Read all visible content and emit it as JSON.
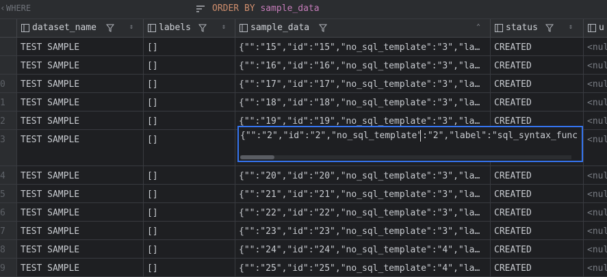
{
  "filter": {
    "where_label": "WHERE",
    "order_keyword": "ORDER BY",
    "order_field": "sample_data"
  },
  "columns": [
    {
      "name": "dataset_name",
      "has_filter": true,
      "has_sort": true
    },
    {
      "name": "labels",
      "has_filter": true,
      "has_sort": true
    },
    {
      "name": "sample_data",
      "has_filter": true,
      "has_sort": true
    },
    {
      "name": "status",
      "has_filter": true,
      "has_sort": true
    },
    {
      "name": "u",
      "has_filter": false,
      "has_sort": false
    }
  ],
  "rows": [
    {
      "num": "",
      "dataset_name": "TEST SAMPLE",
      "labels": "[]",
      "sample_data": "{\"\":\"15\",\"id\":\"15\",\"no_sql_template\":\"3\",\"la…",
      "status": "CREATED",
      "u": "<nul"
    },
    {
      "num": "",
      "dataset_name": "TEST SAMPLE",
      "labels": "[]",
      "sample_data": "{\"\":\"16\",\"id\":\"16\",\"no_sql_template\":\"3\",\"la…",
      "status": "CREATED",
      "u": "<nul"
    },
    {
      "num": "0",
      "dataset_name": "TEST SAMPLE",
      "labels": "[]",
      "sample_data": "{\"\":\"17\",\"id\":\"17\",\"no_sql_template\":\"3\",\"la…",
      "status": "CREATED",
      "u": "<nul"
    },
    {
      "num": "1",
      "dataset_name": "TEST SAMPLE",
      "labels": "[]",
      "sample_data": "{\"\":\"18\",\"id\":\"18\",\"no_sql_template\":\"3\",\"la…",
      "status": "CREATED",
      "u": "<nul"
    },
    {
      "num": "2",
      "dataset_name": "TEST SAMPLE",
      "labels": "[]",
      "sample_data": "{\"\":\"19\",\"id\":\"19\",\"no_sql_template\":\"3\",\"la…",
      "status": "CREATED",
      "u": "<nul"
    },
    {
      "num": "3",
      "dataset_name": "TEST SAMPLE",
      "labels": "[]",
      "sample_data": "",
      "status": "",
      "u": "<nul",
      "editing": true
    },
    {
      "num": "4",
      "dataset_name": "TEST SAMPLE",
      "labels": "[]",
      "sample_data": "{\"\":\"20\",\"id\":\"20\",\"no_sql_template\":\"3\",\"la…",
      "status": "CREATED",
      "u": "<nul"
    },
    {
      "num": "5",
      "dataset_name": "TEST SAMPLE",
      "labels": "[]",
      "sample_data": "{\"\":\"21\",\"id\":\"21\",\"no_sql_template\":\"3\",\"la…",
      "status": "CREATED",
      "u": "<nul"
    },
    {
      "num": "6",
      "dataset_name": "TEST SAMPLE",
      "labels": "[]",
      "sample_data": "{\"\":\"22\",\"id\":\"22\",\"no_sql_template\":\"3\",\"la…",
      "status": "CREATED",
      "u": "<nul"
    },
    {
      "num": "7",
      "dataset_name": "TEST SAMPLE",
      "labels": "[]",
      "sample_data": "{\"\":\"23\",\"id\":\"23\",\"no_sql_template\":\"3\",\"la…",
      "status": "CREATED",
      "u": "<nul"
    },
    {
      "num": "8",
      "dataset_name": "TEST SAMPLE",
      "labels": "[]",
      "sample_data": "{\"\":\"24\",\"id\":\"24\",\"no_sql_template\":\"4\",\"la…",
      "status": "CREATED",
      "u": "<nul"
    },
    {
      "num": "9",
      "dataset_name": "TEST SAMPLE",
      "labels": "[]",
      "sample_data": "{\"\":\"25\",\"id\":\"25\",\"no_sql_template\":\"4\",\"la…",
      "status": "CREATED",
      "u": "<nul"
    }
  ],
  "editor": {
    "value": "{\"\":\"2\",\"id\":\"2\",\"no_sql_template\":\"2\",\"label\":\"sql_syntax_func"
  },
  "colors": {
    "background": "#1e1f22",
    "header_bg": "#2b2d30",
    "accent": "#3574f0",
    "order_keyword": "#cf8e6d",
    "order_field": "#c77dbb"
  }
}
